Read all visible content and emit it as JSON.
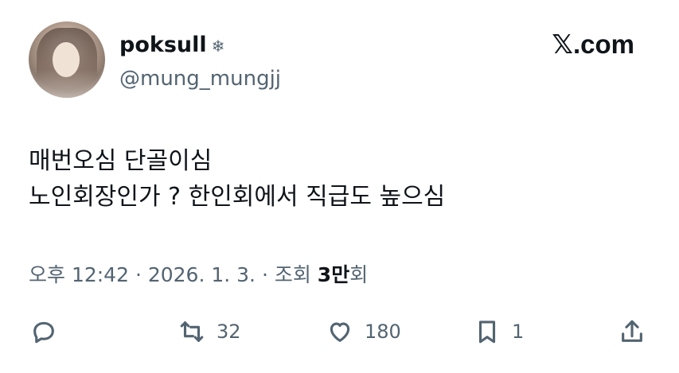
{
  "user": {
    "display_name": "poksull",
    "badge": "❄",
    "handle": "@mung_mungjj"
  },
  "brand": "𝕏.com",
  "tweet": {
    "line1": "매번오심 단골이심",
    "line2": "노인회장인가 ? 한인회에서 직급도 높으심"
  },
  "meta": {
    "prefix": "오후 12:42 · 2026. 1. 3. · 조회 ",
    "views_number": "3만",
    "views_suffix": "회"
  },
  "actions": {
    "reply": {
      "icon": "reply-icon",
      "count": ""
    },
    "retweet": {
      "icon": "retweet-icon",
      "count": "32"
    },
    "like": {
      "icon": "heart-icon",
      "count": "180"
    },
    "bookmark": {
      "icon": "bookmark-icon",
      "count": "1"
    },
    "share": {
      "icon": "share-icon",
      "count": ""
    }
  }
}
